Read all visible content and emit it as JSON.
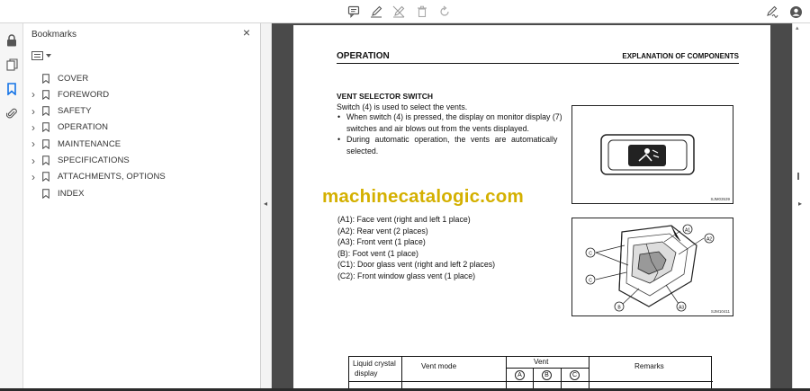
{
  "toolbar": {
    "icons": [
      "comment-icon",
      "pen-icon",
      "sign-icon",
      "delete-icon",
      "rotate-icon",
      "edit-sign-icon",
      "account-icon"
    ]
  },
  "rail": {
    "icons": [
      "lock-icon",
      "pages-icon",
      "bookmark-icon",
      "attachment-icon"
    ]
  },
  "bookmarks": {
    "title": "Bookmarks",
    "close": "×",
    "items": [
      {
        "label": "COVER",
        "expandable": false
      },
      {
        "label": "FOREWORD",
        "expandable": true
      },
      {
        "label": "SAFETY",
        "expandable": true
      },
      {
        "label": "OPERATION",
        "expandable": true
      },
      {
        "label": "MAINTENANCE",
        "expandable": true
      },
      {
        "label": "SPECIFICATIONS",
        "expandable": true
      },
      {
        "label": "ATTACHMENTS, OPTIONS",
        "expandable": true
      },
      {
        "label": "INDEX",
        "expandable": false
      }
    ]
  },
  "page": {
    "header_left": "OPERATION",
    "header_right": "EXPLANATION OF COMPONENTS",
    "section_title": "VENT SELECTOR SWITCH",
    "intro": "Switch (4) is used to select the vents.",
    "bullets": [
      {
        "line1": "When switch (4) is pressed, the display on monitor display (7)",
        "line2": "switches and air blows out from the vents displayed."
      },
      {
        "line1": "During automatic operation, the vents are automatically",
        "line2": "selected."
      }
    ],
    "watermark": "machinecatalogic.com",
    "fig1_caption": "SJM03539",
    "fig2_caption": "SJM10411",
    "vents": [
      "(A1): Face vent (right and left 1 place)",
      "(A2): Rear vent (2 places)",
      "(A3): Front vent (1 place)",
      "(B): Foot vent (1 place)",
      "(C1): Door glass vent (right and left 2 places)",
      "(C2): Front window glass vent (1 place)"
    ],
    "table": {
      "col1_line1": "Liquid crystal",
      "col1_line2": "display",
      "col2": "Vent mode",
      "col3": "Vent",
      "sub_a": "A",
      "sub_b": "B",
      "sub_c": "C",
      "col4": "Remarks"
    },
    "callouts": [
      "A1",
      "A2",
      "A3",
      "B",
      "C"
    ]
  },
  "colors": {
    "watermark": "#d4b000",
    "docview_bg": "#4a4a4a",
    "bookmark_blue": "#1473e6"
  }
}
